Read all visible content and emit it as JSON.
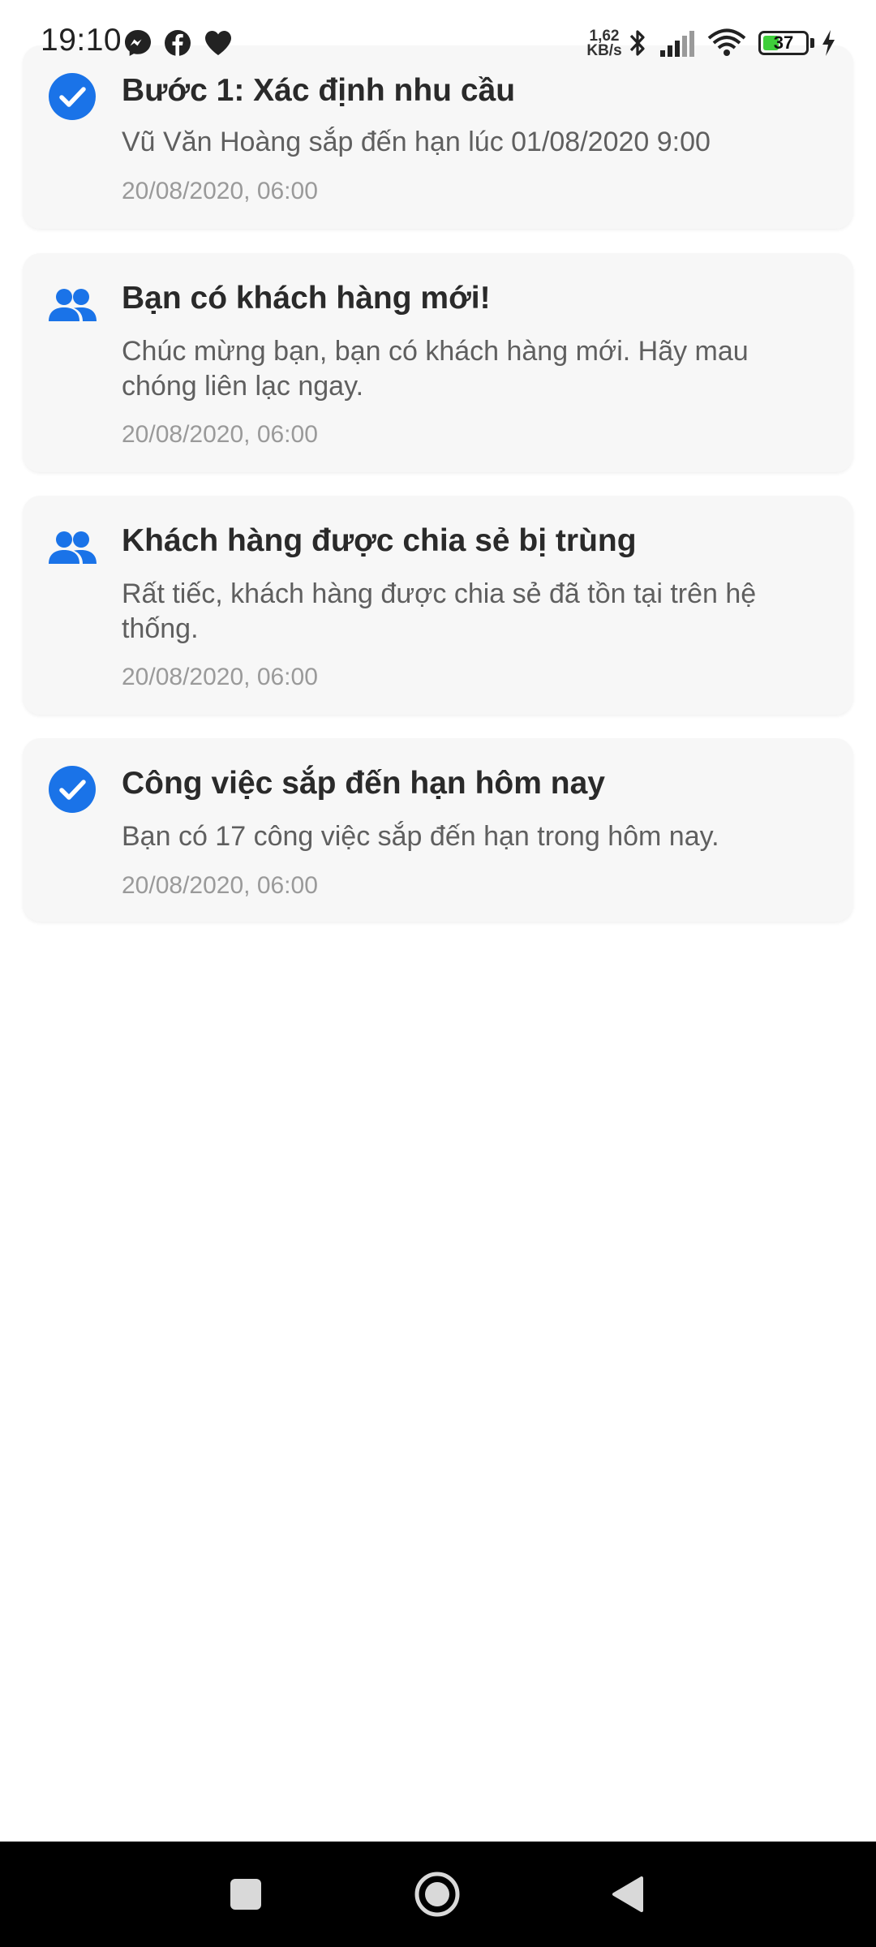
{
  "status_bar": {
    "time": "19:10",
    "speed_value": "1,62",
    "speed_unit": "KB/s",
    "battery_level": "37",
    "battery_fraction": 0.37,
    "icons": [
      "messenger-icon",
      "facebook-icon",
      "heart-icon",
      "bluetooth-icon",
      "signal-icon",
      "wifi-icon",
      "battery-icon",
      "charging-icon"
    ]
  },
  "notifications": [
    {
      "icon": "check-circle-icon",
      "title": "Bước 1: Xác định nhu cầu",
      "body": "Vũ Văn Hoàng sắp đến hạn lúc 01/08/2020 9:00",
      "time": "20/08/2020, 06:00"
    },
    {
      "icon": "users-icon",
      "title": "Bạn có khách hàng mới!",
      "body": "Chúc mừng bạn, bạn có khách hàng mới. Hãy mau chóng liên lạc ngay.",
      "time": "20/08/2020, 06:00"
    },
    {
      "icon": "users-icon",
      "title": "Khách hàng được chia sẻ bị trùng",
      "body": "Rất tiếc, khách hàng được chia sẻ đã tồn tại trên hệ thống.",
      "time": "20/08/2020, 06:00"
    },
    {
      "icon": "check-circle-icon",
      "title": "Công việc sắp đến hạn hôm nay",
      "body": "Bạn có 17 công việc sắp đến hạn trong hôm nay.",
      "time": "20/08/2020, 06:00"
    }
  ],
  "colors": {
    "accent": "#1a73e8",
    "card_background": "#f7f7f7",
    "title_text": "#2a2a2a",
    "body_text": "#5f5f5f",
    "time_text": "#9a9a9a",
    "battery_green": "#3ecf3a"
  },
  "nav_bar": {
    "buttons": [
      "recents-button",
      "home-button",
      "back-button"
    ]
  }
}
